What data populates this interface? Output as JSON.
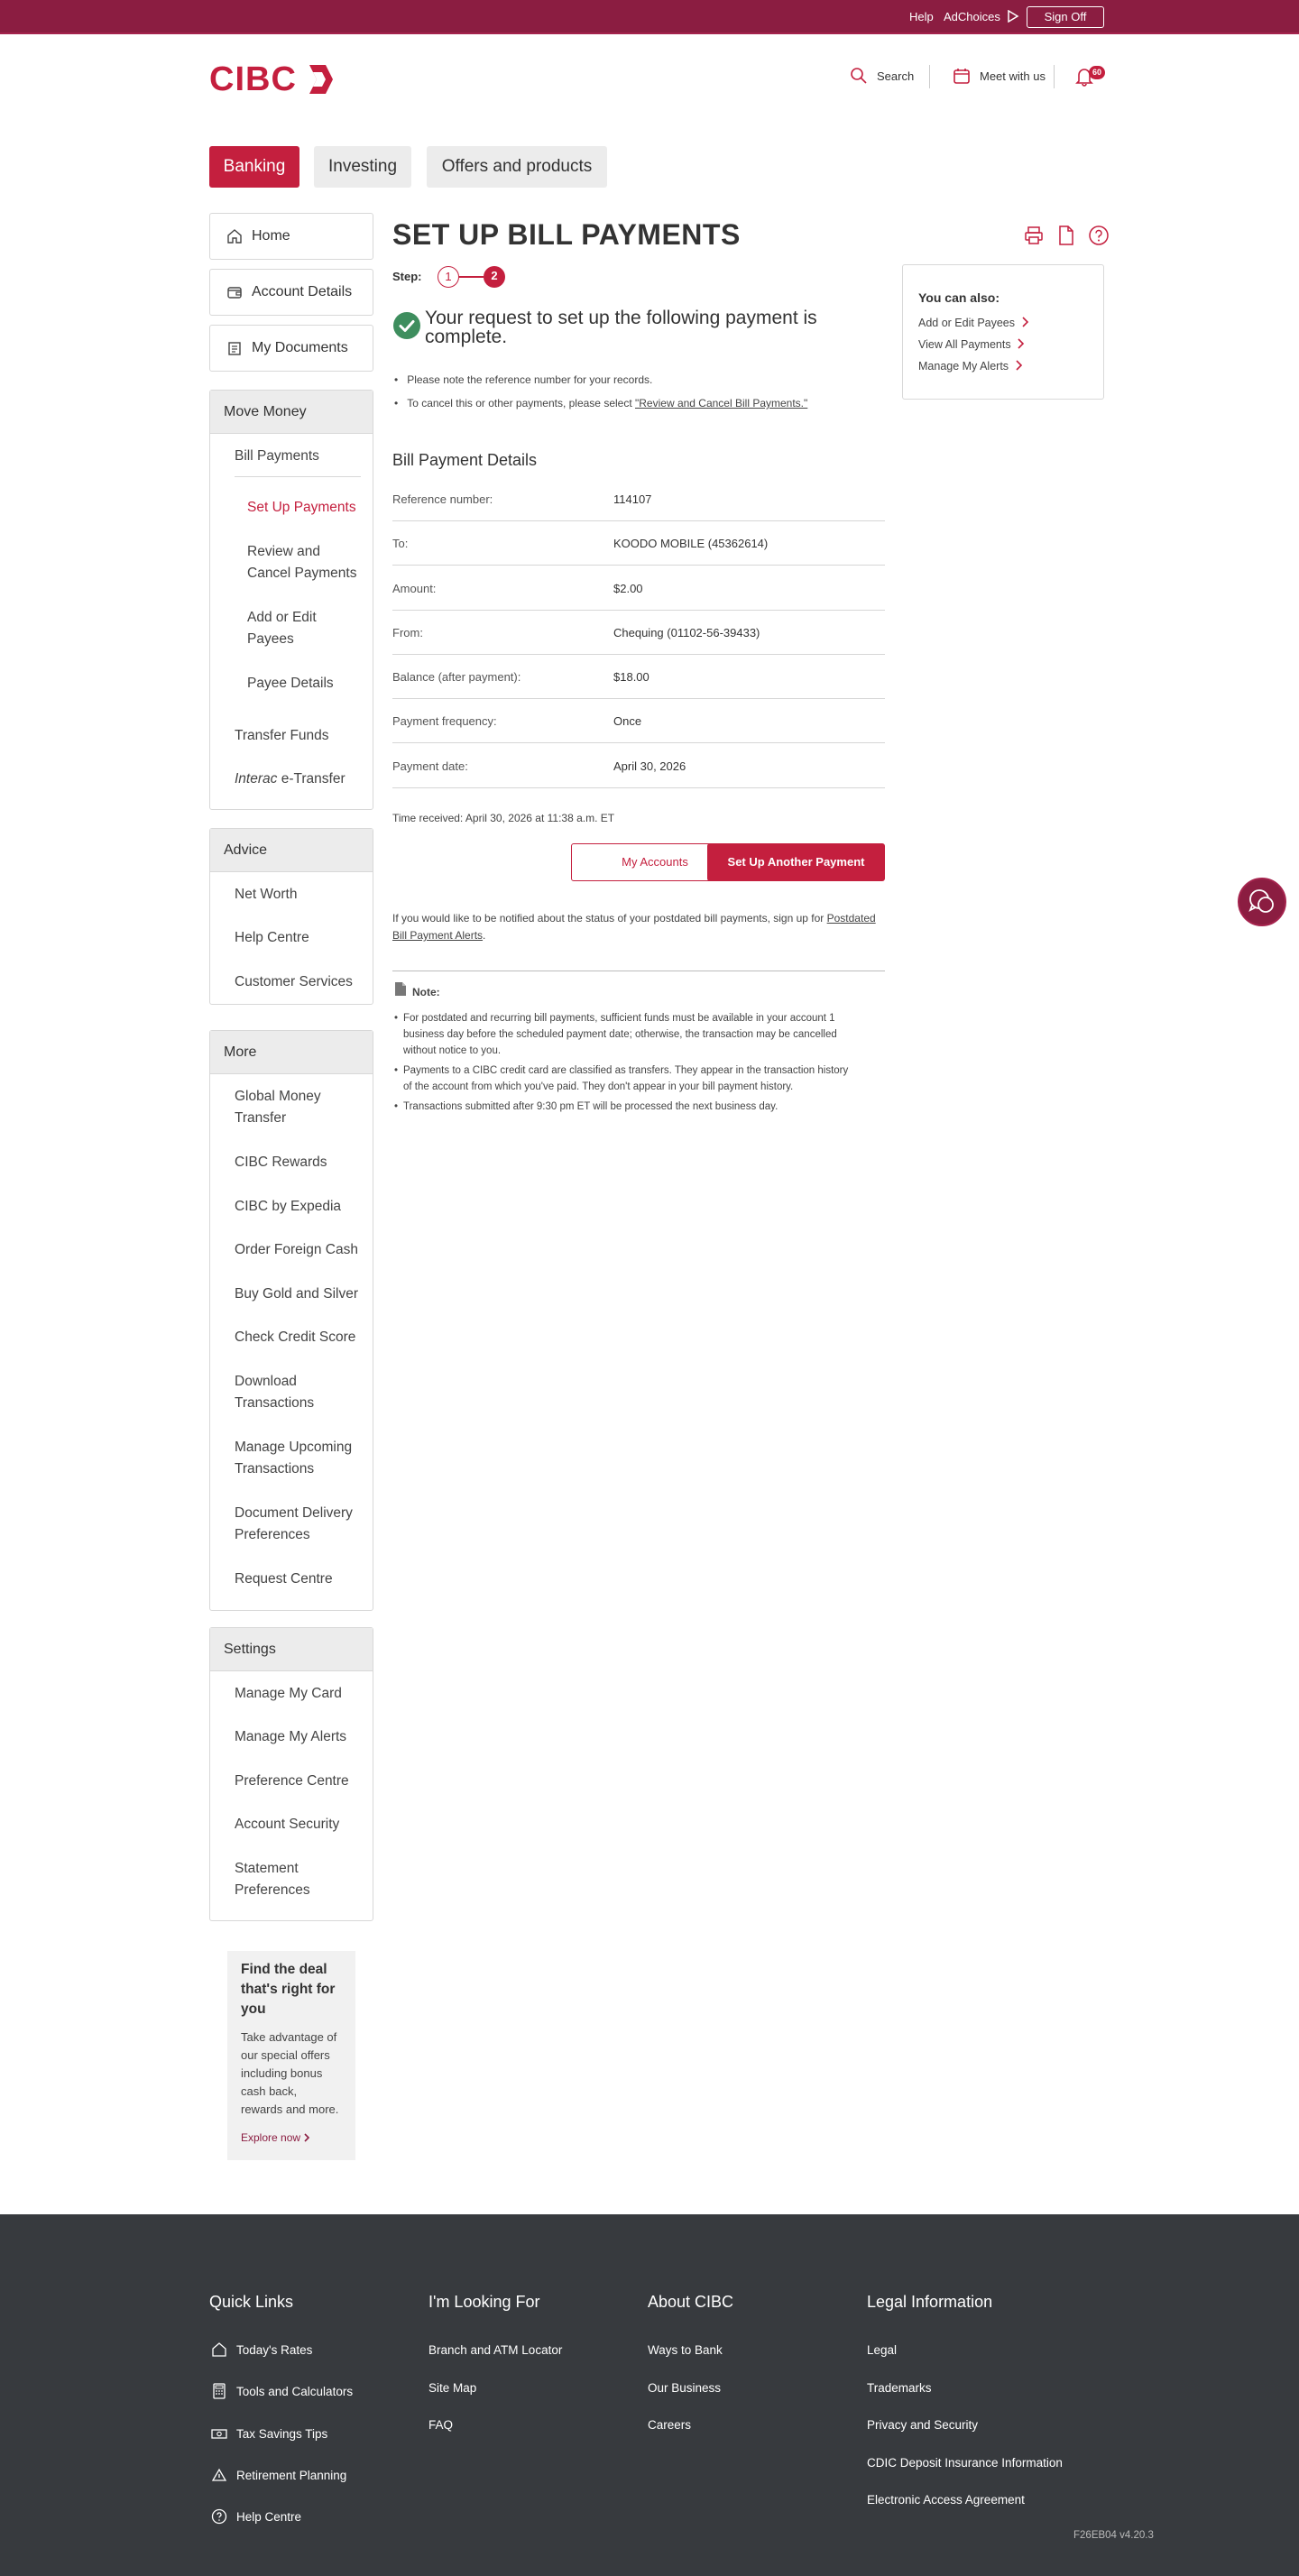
{
  "topbar": {
    "help": "Help",
    "adchoices": "AdChoices",
    "sign_off": "Sign Off"
  },
  "header": {
    "logo": "CIBC",
    "search": "Search",
    "meet": "Meet with us",
    "notifications_count": "60"
  },
  "main_tabs": [
    {
      "label": "Banking"
    },
    {
      "label": "Investing"
    },
    {
      "label": "Offers and products"
    }
  ],
  "sidebar": {
    "home": "Home",
    "account_details": "Account Details",
    "my_documents": "My Documents",
    "move_money": {
      "heading": "Move Money",
      "bill_payments": "Bill Payments",
      "set_up_payments": "Set Up Payments",
      "review_cancel_l1": "Review and",
      "review_cancel_l2": "Cancel Payments",
      "add_edit_l1": "Add or Edit",
      "add_edit_l2": "Payees",
      "payee_details": "Payee Details",
      "transfer_funds": "Transfer Funds",
      "interac_1": "Interac",
      "interac_2": " e-Transfer"
    },
    "advice": {
      "heading": "Advice",
      "items": [
        "Net Worth",
        "Help Centre",
        "Customer Services"
      ]
    },
    "more": {
      "heading": "More",
      "gmt_l1": "Global Money",
      "gmt_l2": "Transfer",
      "rewards": "CIBC Rewards",
      "expedia": "CIBC by Expedia",
      "foreign_cash": "Order Foreign Cash",
      "gold": "Buy Gold and Silver",
      "credit": "Check Credit Score",
      "dl_l1": "Download",
      "dl_l2": "Transactions",
      "mu_l1": "Manage Upcoming",
      "mu_l2": "Transactions",
      "dd_l1": "Document Delivery",
      "dd_l2": "Preferences",
      "request": "Request Centre"
    },
    "settings": {
      "heading": "Settings",
      "card": "Manage My Card",
      "alerts": "Manage My Alerts",
      "pref": "Preference Centre",
      "security": "Account Security",
      "sp_l1": "Statement",
      "sp_l2": "Preferences"
    },
    "promo": {
      "title_l1": "Find the deal",
      "title_l2": "that's right for",
      "title_l3": "you",
      "b1": "Take advantage of",
      "b2": "our special offers",
      "b3": "including bonus",
      "b4": "cash back,",
      "b5": "rewards and more.",
      "link": "Explore now"
    }
  },
  "content": {
    "title": "SET UP BILL PAYMENTS",
    "step_label": "Step:",
    "step1": "1",
    "step2": "2",
    "success_l1": "Your request to set up the following payment is",
    "success_l2": "complete.",
    "bullet1": "Please note the reference number for your records.",
    "bullet2_pre": "To cancel this or other payments, please select ",
    "bullet2_link": "\"Review and Cancel Bill Payments.\"",
    "details_heading": "Bill Payment Details",
    "rows": [
      {
        "label": "Reference number:",
        "value": "114107"
      },
      {
        "label": "To:",
        "value": "KOODO MOBILE (45362614)"
      },
      {
        "label": "Amount:",
        "value": "$2.00"
      },
      {
        "label": "From:",
        "value": "Chequing (01102-56-39433)"
      },
      {
        "label": "Balance (after payment):",
        "value": "$18.00"
      },
      {
        "label": "Payment frequency:",
        "value": "Once"
      },
      {
        "label": "Payment date:",
        "value": "April 30, 2026"
      }
    ],
    "time_received": "Time received: April 30, 2026 at 11:38 a.m. ET",
    "btn_accounts": "My Accounts",
    "btn_another": "Set Up Another Payment",
    "notify_pre": "If you would like to be notified about the status of your postdated bill payments, sign up for ",
    "notify_link_1": "Postdated",
    "notify_link_2": "Bill Payment Alerts",
    "notify_end": ".",
    "note_heading": "Note:",
    "n1_l1": "For postdated and recurring bill payments, sufficient funds must be available in your account 1",
    "n1_l2": "business day before the scheduled payment date; otherwise, the transaction may be cancelled",
    "n1_l3": "without notice to you.",
    "n2_l1": "Payments to a CIBC credit card are classified as transfers. They appear in the transaction history",
    "n2_l2": "of the account from which you've paid. They don't appear in your bill payment history.",
    "n3": "Transactions submitted after 9:30 pm ET will be processed the next business day."
  },
  "side_card": {
    "heading": "You can also:",
    "links": [
      "Add or Edit Payees",
      "View All Payments",
      "Manage My Alerts"
    ]
  },
  "footer": {
    "col1": {
      "heading": "Quick Links",
      "items": [
        "Today's Rates",
        "Tools and Calculators",
        "Tax Savings Tips",
        "Retirement Planning",
        "Help Centre"
      ]
    },
    "col2": {
      "heading": "I'm Looking For",
      "items": [
        "Branch and ATM Locator",
        "Site Map",
        "FAQ"
      ]
    },
    "col3": {
      "heading": "About CIBC",
      "items": [
        "Ways to Bank",
        "Our Business",
        "Careers"
      ]
    },
    "col4": {
      "heading": "Legal Information",
      "items": [
        "Legal",
        "Trademarks",
        "Privacy and Security",
        "CDIC Deposit Insurance Information",
        "Electronic Access Agreement"
      ]
    },
    "version": "F26EB04 v4.20.3"
  },
  "colors": {
    "brand": "#c41f3e",
    "topbar": "#8b1d41",
    "footer": "#373a3e",
    "success": "#3e8e5e"
  }
}
